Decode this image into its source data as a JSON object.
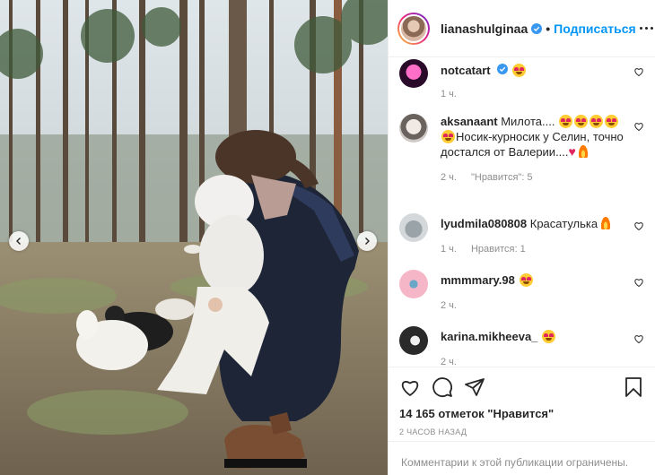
{
  "post": {
    "author": "lianashulginaa",
    "separator": "•",
    "follow_label": "Подписаться",
    "photo_description_icon": "photo-icon"
  },
  "comments": [
    {
      "user": "notcatart",
      "text": "",
      "emojis": [
        "heart-eyes"
      ],
      "time": "1 ч.",
      "likes": "",
      "verified": true
    },
    {
      "user": "aksanaant",
      "text": "Милота....",
      "text2": "Носик-курносик у Селин, точно достался от Валерии....",
      "time": "2 ч.",
      "likes": "\"Нравится\": 5"
    },
    {
      "user": "lyudmila080808",
      "text": "Красатулька",
      "time": "1 ч.",
      "likes": "Нравится: 1"
    },
    {
      "user": "mmmmary.98",
      "text": "",
      "time": "2 ч.",
      "likes": ""
    },
    {
      "user": "karina.mikheeva_",
      "text": "",
      "time": "2 ч.",
      "likes": ""
    }
  ],
  "footer": {
    "likes_count": "14 165 отметок \"Нравится\"",
    "posted_ago": "2 ЧАСОВ НАЗАД",
    "comments_limited": "Комментарии к этой публикации ограничены."
  },
  "colors": {
    "accent": "#0095f6",
    "text": "#262626",
    "muted": "#8e8e8e",
    "border": "#efefef"
  }
}
